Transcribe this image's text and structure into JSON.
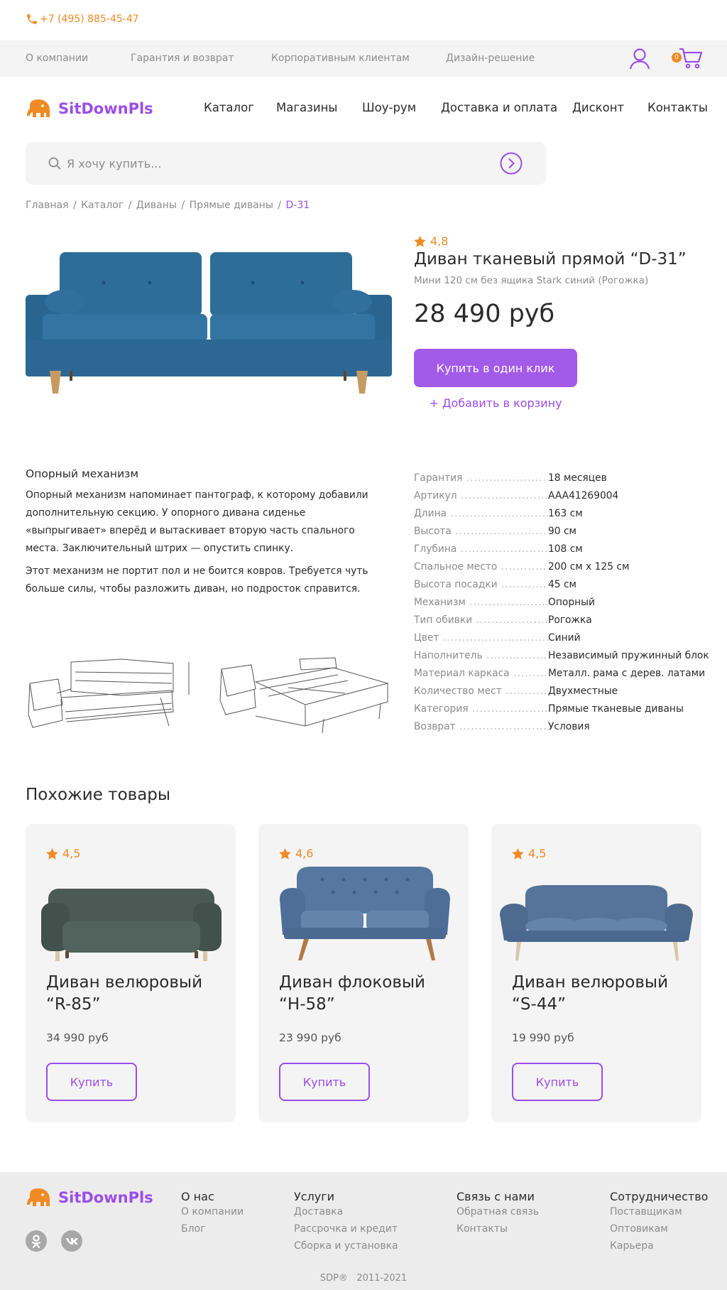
{
  "topbar": {
    "phone": "+7 (495) 885-45-47",
    "phone_icon": "phone-icon"
  },
  "subnav": {
    "items": [
      "О компании",
      "Гарантия и возврат",
      "Корпоративным клиентам",
      "Дизайн-решение"
    ],
    "cart_count": "0",
    "user_icon": "user-icon",
    "cart_icon": "cart-icon"
  },
  "header": {
    "logo": "SitDownPls",
    "nav": [
      "Каталог",
      "Магазины",
      "Шоу-рум",
      "Доставка и оплата",
      "Дисконт",
      "Контакты"
    ]
  },
  "search": {
    "placeholder": "Я хочу купить...",
    "search_icon": "search-icon",
    "submit_icon": "arrow-right-circle-icon"
  },
  "breadcrumb": {
    "items": [
      "Главная",
      "Каталог",
      "Диваны",
      "Прямые диваны"
    ],
    "current": "D-31"
  },
  "product": {
    "rating": "4,8",
    "title": "Диван тканевый прямой “D-31”",
    "subtitle": "Мини 120 см без ящика Stark синий (Рогожка)",
    "price": "28 490 руб",
    "buy_one_click": "Купить в один клик",
    "add_to_cart": "+ Добавить в корзину",
    "image": "blue-sofa-image"
  },
  "description": {
    "title": "Опорный механизм",
    "paragraphs": [
      "Опорный механизм напоминает пантограф, к которому добавили дополнительную секцию. У опорного дивана сиденье «выпрыгивает» вперёд и вытаскивает вторую часть спального места. Заключительный штрих — опустить спинку.",
      "Этот механизм не портит пол и не боится ковров. Требуется чуть больше силы, чтобы разложить диван, но подросток справится."
    ]
  },
  "specs": [
    {
      "key": "Гарантия",
      "value": "18 месяцев"
    },
    {
      "key": "Артикул",
      "value": "AAA41269004"
    },
    {
      "key": "Длина",
      "value": "163 см"
    },
    {
      "key": "Высота",
      "value": "90 см"
    },
    {
      "key": "Глубина",
      "value": "108 см"
    },
    {
      "key": "Спальное место",
      "value": "200 см х 125 см"
    },
    {
      "key": "Высота посадки",
      "value": "45 см"
    },
    {
      "key": "Механизм",
      "value": "Опорный"
    },
    {
      "key": "Тип обивки",
      "value": "Рогожка"
    },
    {
      "key": "Цвет",
      "value": "Синий"
    },
    {
      "key": "Наполнитель",
      "value": "Независимый пружинный блок"
    },
    {
      "key": "Материал каркаса",
      "value": "Металл. рама с дерев. латами"
    },
    {
      "key": "Количество мест",
      "value": "Двухместные"
    },
    {
      "key": "Категория",
      "value": "Прямые тканевые диваны"
    },
    {
      "key": "Возврат",
      "value": "Условия"
    }
  ],
  "similar": {
    "title": "Похожие товары",
    "items": [
      {
        "rating": "4,5",
        "name": "Диван велюровый “R-85”",
        "price": "34 990 руб",
        "buy": "Купить",
        "color": "#4b5a55"
      },
      {
        "rating": "4,6",
        "name": "Диван флоковый “H-58”",
        "price": "23 990 руб",
        "buy": "Купить",
        "color": "#5677a0"
      },
      {
        "rating": "4,5",
        "name": "Диван велюровый “S-44”",
        "price": "19 990 руб",
        "buy": "Купить",
        "color": "#567499"
      }
    ]
  },
  "footer": {
    "logo": "SitDownPls",
    "columns": [
      {
        "title": "О нас",
        "links": [
          "О компании",
          "Блог"
        ]
      },
      {
        "title": "Услуги",
        "links": [
          "Доставка",
          "Рассрочка и кредит",
          "Сборка и установка"
        ]
      },
      {
        "title": "Связь с нами",
        "links": [
          "Обратная связь",
          "Контакты"
        ]
      },
      {
        "title": "Сотрудничество",
        "links": [
          "Поставщикам",
          "Оптовикам",
          "Карьера"
        ]
      }
    ],
    "social_icons": [
      "odnoklassniki-icon",
      "vk-icon"
    ],
    "copyright": "SDP®   2011-2021"
  },
  "colors": {
    "accent": "#9b4dea",
    "orange": "#f08a24",
    "sofa_blue": "#2d6a96"
  }
}
